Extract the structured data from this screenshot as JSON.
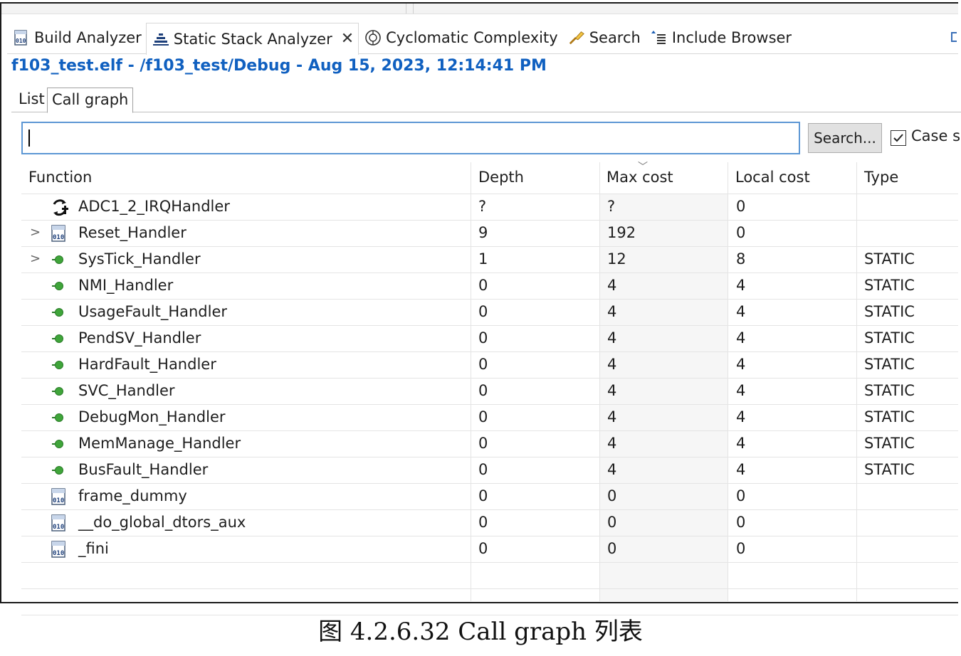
{
  "tabs": [
    {
      "label": "Build Analyzer",
      "icon": "binary-file-icon"
    },
    {
      "label": "Static Stack Analyzer",
      "icon": "stack-icon",
      "active": true
    },
    {
      "label": "Cyclomatic Complexity",
      "icon": "complexity-icon"
    },
    {
      "label": "Search",
      "icon": "search-icon"
    },
    {
      "label": "Include Browser",
      "icon": "include-icon"
    }
  ],
  "title": "f103_test.elf - /f103_test/Debug - Aug 15, 2023, 12:14:41 PM",
  "subtabs": {
    "list": "List",
    "callgraph": "Call graph"
  },
  "search": {
    "value": "",
    "button": "Search...",
    "case_label": "Case s",
    "case_checked": true
  },
  "columns": {
    "function": "Function",
    "depth": "Depth",
    "max_cost": "Max cost",
    "local_cost": "Local cost",
    "type": "Type"
  },
  "rows": [
    {
      "fn": "ADC1_2_IRQHandler",
      "depth": "?",
      "max": "?",
      "local": "0",
      "type": "",
      "icon": "recursion-icon",
      "expandable": false
    },
    {
      "fn": "Reset_Handler",
      "depth": "9",
      "max": "192",
      "local": "0",
      "type": "",
      "icon": "binary-file-icon",
      "expandable": true
    },
    {
      "fn": "SysTick_Handler",
      "depth": "1",
      "max": "12",
      "local": "8",
      "type": "STATIC",
      "icon": "function-icon",
      "expandable": true
    },
    {
      "fn": "NMI_Handler",
      "depth": "0",
      "max": "4",
      "local": "4",
      "type": "STATIC",
      "icon": "function-icon",
      "expandable": false
    },
    {
      "fn": "UsageFault_Handler",
      "depth": "0",
      "max": "4",
      "local": "4",
      "type": "STATIC",
      "icon": "function-icon",
      "expandable": false
    },
    {
      "fn": "PendSV_Handler",
      "depth": "0",
      "max": "4",
      "local": "4",
      "type": "STATIC",
      "icon": "function-icon",
      "expandable": false
    },
    {
      "fn": "HardFault_Handler",
      "depth": "0",
      "max": "4",
      "local": "4",
      "type": "STATIC",
      "icon": "function-icon",
      "expandable": false
    },
    {
      "fn": "SVC_Handler",
      "depth": "0",
      "max": "4",
      "local": "4",
      "type": "STATIC",
      "icon": "function-icon",
      "expandable": false
    },
    {
      "fn": "DebugMon_Handler",
      "depth": "0",
      "max": "4",
      "local": "4",
      "type": "STATIC",
      "icon": "function-icon",
      "expandable": false
    },
    {
      "fn": "MemManage_Handler",
      "depth": "0",
      "max": "4",
      "local": "4",
      "type": "STATIC",
      "icon": "function-icon",
      "expandable": false
    },
    {
      "fn": "BusFault_Handler",
      "depth": "0",
      "max": "4",
      "local": "4",
      "type": "STATIC",
      "icon": "function-icon",
      "expandable": false
    },
    {
      "fn": "frame_dummy",
      "depth": "0",
      "max": "0",
      "local": "0",
      "type": "",
      "icon": "binary-file-icon",
      "expandable": false
    },
    {
      "fn": "__do_global_dtors_aux",
      "depth": "0",
      "max": "0",
      "local": "0",
      "type": "",
      "icon": "binary-file-icon",
      "expandable": false
    },
    {
      "fn": "_fini",
      "depth": "0",
      "max": "0",
      "local": "0",
      "type": "",
      "icon": "binary-file-icon",
      "expandable": false
    }
  ],
  "caption": "图 4.2.6.32  Call graph 列表",
  "colors": {
    "title": "#1060c0",
    "input_border": "#5d97d4",
    "static_icon": "#3fa53a"
  }
}
